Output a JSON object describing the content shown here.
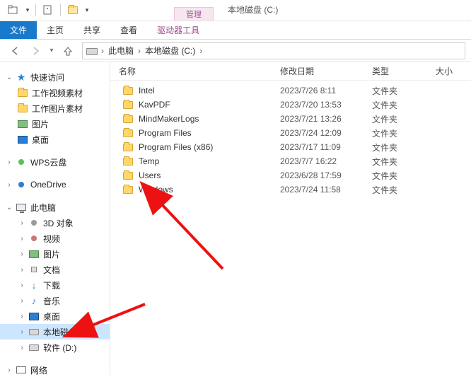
{
  "ribbon": {
    "context_label": "管理",
    "title": "本地磁盘 (C:)",
    "file_tab": "文件",
    "tabs": [
      "主页",
      "共享",
      "查看"
    ],
    "context_tab": "驱动器工具"
  },
  "breadcrumb": {
    "pc": "此电脑",
    "drive": "本地磁盘 (C:)"
  },
  "columns": {
    "name": "名称",
    "date": "修改日期",
    "type": "类型",
    "size": "大小"
  },
  "folder_type": "文件夹",
  "rows": [
    {
      "name": "Intel",
      "date": "2023/7/26 8:11"
    },
    {
      "name": "KavPDF",
      "date": "2023/7/20 13:53"
    },
    {
      "name": "MindMakerLogs",
      "date": "2023/7/21 13:26"
    },
    {
      "name": "Program Files",
      "date": "2023/7/24 12:09"
    },
    {
      "name": "Program Files (x86)",
      "date": "2023/7/17 11:09"
    },
    {
      "name": "Temp",
      "date": "2023/7/7 16:22"
    },
    {
      "name": "Users",
      "date": "2023/6/28 17:59"
    },
    {
      "name": "Windows",
      "date": "2023/7/24 11:58"
    }
  ],
  "tree": {
    "quick_access": "快速访问",
    "qa_items": [
      "工作视频素材",
      "工作图片素材",
      "图片",
      "桌面"
    ],
    "wps": "WPS云盘",
    "onedrive": "OneDrive",
    "this_pc": "此电脑",
    "pc_items": [
      "3D 对象",
      "视频",
      "图片",
      "文档",
      "下载",
      "音乐",
      "桌面"
    ],
    "drives": [
      "本地磁盘 (C:)",
      "软件 (D:)"
    ],
    "network": "网络"
  }
}
